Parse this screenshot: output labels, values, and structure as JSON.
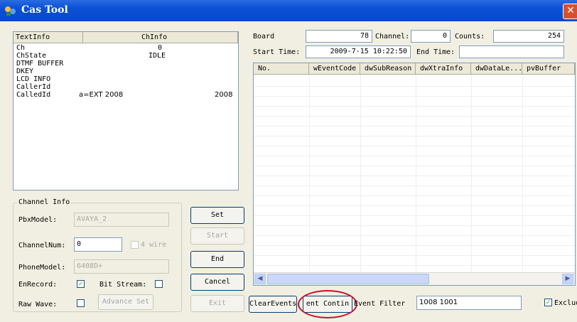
{
  "window": {
    "title": "Cas Tool",
    "close_glyph": "✕"
  },
  "info_list": {
    "columns": [
      "TextInfo",
      "ChInfo"
    ],
    "rows": [
      {
        "key": "Ch",
        "value": "0",
        "extra": ""
      },
      {
        "key": "ChState",
        "value": "IDLE",
        "extra": ""
      },
      {
        "key": "DTMF BUFFER",
        "value": "",
        "extra": ""
      },
      {
        "key": "DKEY",
        "value": "",
        "extra": ""
      },
      {
        "key": "LCD INFO",
        "value": "",
        "extra": ""
      },
      {
        "key": "CallerId",
        "value": "",
        "extra": ""
      },
      {
        "key": "CalledId",
        "value": "a=EXT 2008",
        "extra": "2008"
      }
    ]
  },
  "status": {
    "board_label": "Board",
    "board_value": "78",
    "channel_label": "Channel:",
    "channel_value": "0",
    "counts_label": "Counts:",
    "counts_value": "254",
    "start_time_label": "Start Time:",
    "start_time_value": "2009-7-15 10:22:50",
    "end_time_label": "End Time:",
    "end_time_value": ""
  },
  "events_table": {
    "columns": [
      "No.",
      "wEventCode",
      "dwSubReason",
      "dwXtraInfo",
      "dwDataLe...",
      "pvBuffer"
    ]
  },
  "channel_info": {
    "group_label": "Channel Info",
    "pbx_model_label": "PbxModel:",
    "pbx_model_value": "AVAYA_2",
    "channel_num_label": "ChannelNum:",
    "channel_num_value": "0",
    "four_wire_label": "4 wire",
    "phone_model_label": "PhoneModel:",
    "phone_model_value": "6408D+",
    "en_record_label": "EnRecord:",
    "en_record_checked": true,
    "bit_stream_label": "Bit Stream:",
    "bit_stream_checked": false,
    "raw_wave_label": "Raw Wave:",
    "raw_wave_checked": false,
    "advance_set_label": "Advance Set"
  },
  "buttons": {
    "set": "Set",
    "start": "Start",
    "end": "End",
    "cancel": "Cancel",
    "exit": "Exit",
    "clear_events": "ClearEvents",
    "event_continue": "ent Contin",
    "event_filter_label": "Event Filter",
    "event_filter_value": "1008 1001",
    "exclude_label": "Exclude",
    "exclude_checked": true
  },
  "scrollbar": {
    "left_arrow": "◀",
    "right_arrow": "▶"
  },
  "colors": {
    "titlebar": "#0a50d6",
    "highlight": "#c8102e",
    "window_bg": "#f1efe2"
  }
}
